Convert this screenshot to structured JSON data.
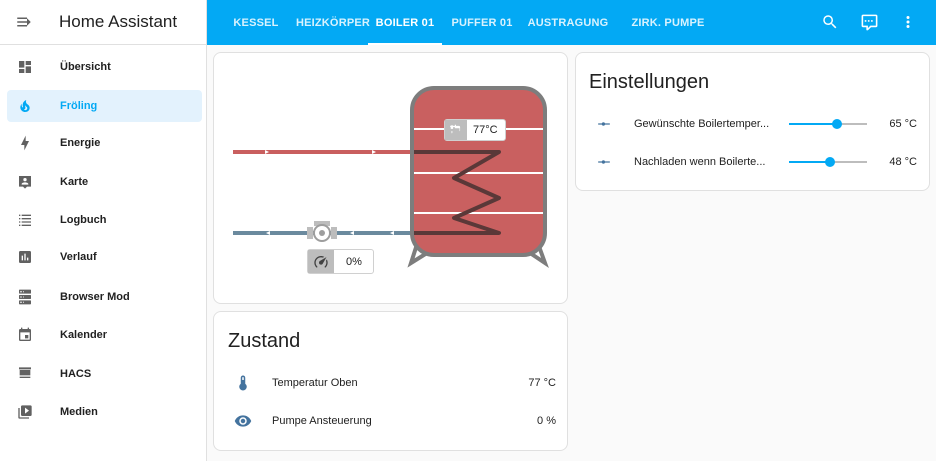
{
  "app": {
    "title": "Home Assistant"
  },
  "sidebar": {
    "items": [
      {
        "label": "Übersicht",
        "icon": "dashboard-icon",
        "active": false
      },
      {
        "label": "Fröling",
        "icon": "fire-icon",
        "active": true
      },
      {
        "label": "Energie",
        "icon": "lightning-icon",
        "active": false
      },
      {
        "label": "Karte",
        "icon": "map-account-icon",
        "active": false
      },
      {
        "label": "Logbuch",
        "icon": "list-icon",
        "active": false
      },
      {
        "label": "Verlauf",
        "icon": "chart-box-icon",
        "active": false
      },
      {
        "label": "Browser Mod",
        "icon": "server-icon",
        "active": false
      },
      {
        "label": "Kalender",
        "icon": "calendar-icon",
        "active": false
      },
      {
        "label": "HACS",
        "icon": "hacs-icon",
        "active": false
      },
      {
        "label": "Medien",
        "icon": "play-box-icon",
        "active": false
      }
    ]
  },
  "tabs": [
    {
      "label": "KESSEL",
      "active": false
    },
    {
      "label": "HEIZKÖRPER",
      "active": false
    },
    {
      "label": "BOILER 01",
      "active": true
    },
    {
      "label": "PUFFER 01",
      "active": false
    },
    {
      "label": "AUSTRAGUNG",
      "active": false
    },
    {
      "label": "ZIRK. PUMPE",
      "active": false
    }
  ],
  "diagram": {
    "boiler_temp": "77°C",
    "pump_value": "0%"
  },
  "zustand": {
    "title": "Zustand",
    "rows": [
      {
        "label": "Temperatur Oben",
        "value": "77 °C",
        "icon": "thermometer-icon"
      },
      {
        "label": "Pumpe Ansteuerung",
        "value": "0 %",
        "icon": "eye-icon"
      }
    ]
  },
  "einstellungen": {
    "title": "Einstellungen",
    "rows": [
      {
        "label": "Gewünschte Boilertemper...",
        "value": "65 °C",
        "fraction": 0.61,
        "icon": "slider-icon"
      },
      {
        "label": "Nachladen wenn Boilerte...",
        "value": "48 °C",
        "fraction": 0.53,
        "icon": "slider-icon"
      }
    ]
  },
  "colors": {
    "accent": "#03a9f4",
    "sidebar_active_bg": "#e3f2fd",
    "hot_pipe": "#c95f5f",
    "cold_pipe": "#6b8a9e",
    "tank": "#c96060",
    "tank_outline": "#7d7d7d"
  }
}
